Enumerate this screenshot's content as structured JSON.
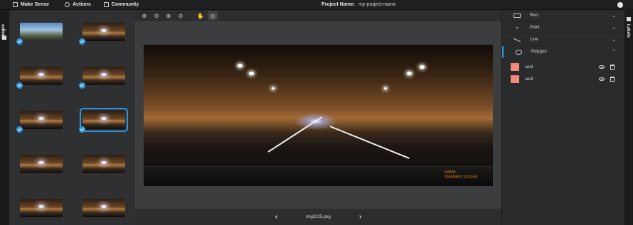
{
  "topbar": {
    "app_name": "Make Sense",
    "menu": [
      {
        "label": "Actions",
        "icon": "gear-cluster-icon"
      },
      {
        "label": "Community",
        "icon": "community-icon"
      }
    ],
    "project_label": "Project Name:",
    "project_name": "my-project-name",
    "github_icon": "github-icon"
  },
  "left_tab": {
    "label": "Images"
  },
  "right_tab": {
    "label": "Labels"
  },
  "image_list": {
    "thumbnails": [
      {
        "kind": "sky",
        "checked": true,
        "selected": false
      },
      {
        "kind": "tunnel",
        "checked": true,
        "selected": false
      },
      {
        "kind": "tunnel",
        "checked": true,
        "selected": false
      },
      {
        "kind": "tunnel",
        "checked": true,
        "selected": false
      },
      {
        "kind": "tunnel",
        "checked": true,
        "selected": false
      },
      {
        "kind": "tunnel",
        "checked": true,
        "selected": true
      },
      {
        "kind": "tunnel",
        "checked": false,
        "selected": false
      },
      {
        "kind": "tunnel",
        "checked": false,
        "selected": false
      },
      {
        "kind": "tunnel",
        "checked": false,
        "selected": false
      },
      {
        "kind": "tunnel",
        "checked": false,
        "selected": false
      }
    ]
  },
  "toolbar": {
    "buttons": [
      {
        "icon": "zoom-in-icon",
        "glyph": "⊕"
      },
      {
        "icon": "zoom-out-icon",
        "glyph": "⊖"
      },
      {
        "icon": "zoom-fit-icon",
        "glyph": "⊗"
      },
      {
        "icon": "zoom-max-icon",
        "glyph": "⊘"
      },
      {
        "icon": "hand-icon",
        "glyph": "✋"
      },
      {
        "icon": "crosshair-icon",
        "glyph": "◎"
      }
    ]
  },
  "canvas": {
    "stamp_line1": "KZA00",
    "stamp_line2": "2018/08/07 12:33:00"
  },
  "navigation": {
    "prev": "‹",
    "filename": "img0225.png",
    "next": "›"
  },
  "label_tools": [
    {
      "name": "Rect",
      "icon": "rect-icon",
      "expanded": false
    },
    {
      "name": "Point",
      "icon": "point-icon",
      "expanded": false
    },
    {
      "name": "Line",
      "icon": "line-icon",
      "expanded": false
    },
    {
      "name": "Polygon",
      "icon": "polygon-icon",
      "expanded": true
    }
  ],
  "polygon_labels": [
    {
      "name": "serit",
      "color": "#f08a7d"
    },
    {
      "name": "serit",
      "color": "#f08a7d"
    }
  ]
}
